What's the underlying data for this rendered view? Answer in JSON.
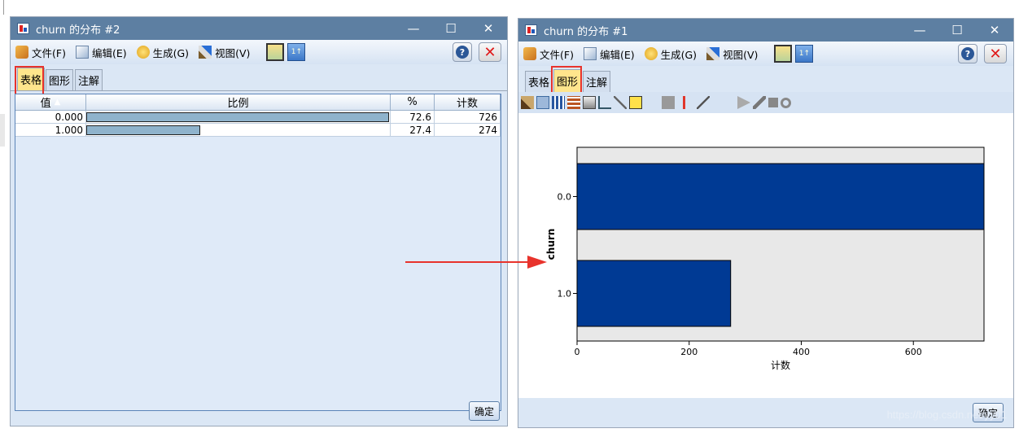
{
  "left_window": {
    "title": "churn 的分布 #2",
    "menu": {
      "file": "文件(F)",
      "edit": "编辑(E)",
      "generate": "生成(G)",
      "view": "视图(V)"
    },
    "tabs": [
      "表格",
      "图形",
      "注解"
    ],
    "active_tab": "表格",
    "table": {
      "headers": [
        "值",
        "比例",
        "%",
        "计数"
      ],
      "rows": [
        {
          "value": "0.000",
          "proportion": 0.726,
          "percent": "72.6",
          "count": "726"
        },
        {
          "value": "1.000",
          "proportion": 0.274,
          "percent": "27.4",
          "count": "274"
        }
      ]
    },
    "ok_label": "确定"
  },
  "right_window": {
    "title": "churn 的分布 #1",
    "menu": {
      "file": "文件(F)",
      "edit": "编辑(E)",
      "generate": "生成(G)",
      "view": "视图(V)"
    },
    "tabs": [
      "表格",
      "图形",
      "注解"
    ],
    "active_tab": "图形",
    "ok_label": "确定"
  },
  "chart_data": {
    "type": "bar",
    "orientation": "horizontal",
    "categories": [
      "0.0",
      "1.0"
    ],
    "values": [
      726,
      274
    ],
    "xlabel": "计数",
    "ylabel": "churn",
    "xlim": [
      0,
      726
    ],
    "xticks": [
      "0",
      "200",
      "400",
      "600"
    ],
    "bar_color": "#003a94",
    "plot_background": "#e8e8e8"
  },
  "watermark": "https://blog.csdn.net/yy01",
  "colors": {
    "accent_red": "#e8332c",
    "active_tab": "#ffe58c",
    "titlebar": "#5d7fa2"
  }
}
